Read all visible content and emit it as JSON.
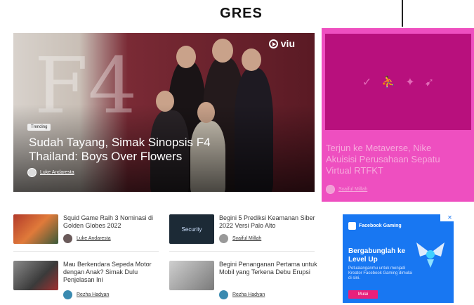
{
  "section": {
    "title": "GRES"
  },
  "hero": {
    "brand": "viu",
    "tag": "Trending",
    "title": "Sudah Tayang, Simak Sinopsis F4 Thailand: Boys Over Flowers",
    "author": "Luke Andaresta"
  },
  "side": {
    "title": "Terjun ke Metaverse, Nike Akuisisi Perusahaan Sepatu Virtual RTFKT",
    "author": "Syaiful Millah"
  },
  "articles": [
    {
      "title": "Squid Game Raih 3 Nominasi di Golden Globes 2022",
      "author": "Luke Andaresta"
    },
    {
      "title": "Begini 5 Prediksi Keamanan Siber 2022 Versi Palo Alto",
      "author": "Syaiful Millah",
      "thumb_text": "Security"
    },
    {
      "title": "Mau Berkendara Sepeda Motor dengan Anak? Simak Dulu Penjelasan Ini",
      "author": "Rezha Hadyan"
    },
    {
      "title": "Begini Penanganan Pertama untuk Mobil yang Terkena Debu Erupsi",
      "author": "Rezha Hadyan"
    }
  ],
  "ad": {
    "brand": "Facebook Gaming",
    "headline": "Bergabunglah ke Level Up",
    "description": "Petualanganmu untuk menjadi Kreator Facebook Gaming dimulai di sini.",
    "button": "Mulai",
    "close": "✕"
  },
  "colors": {
    "accent_pink": "#ee4fc0",
    "facebook_blue": "#1877f2",
    "ad_button": "#e8207b"
  }
}
